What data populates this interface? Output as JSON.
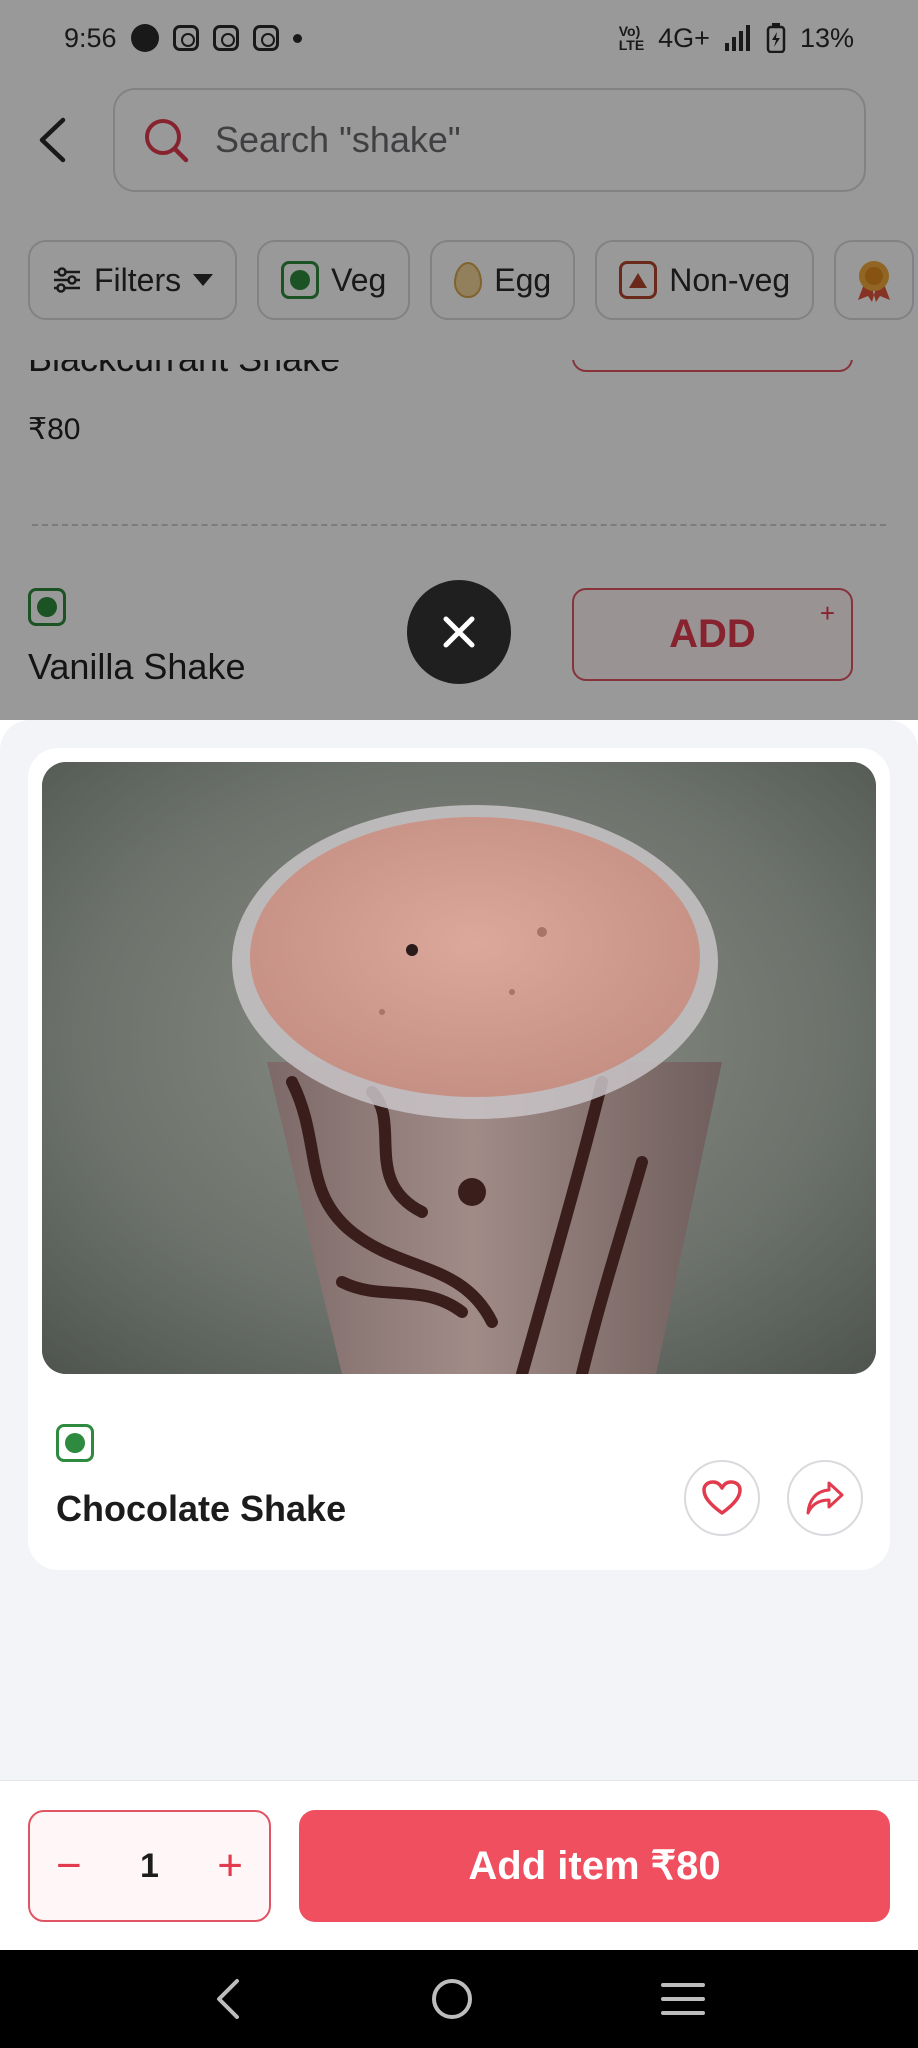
{
  "status_bar": {
    "time": "9:56",
    "network": "4G+",
    "battery": "13%"
  },
  "search": {
    "placeholder": "Search \"shake\""
  },
  "filters": [
    {
      "label": "Filters"
    },
    {
      "label": "Veg"
    },
    {
      "label": "Egg"
    },
    {
      "label": "Non-veg"
    }
  ],
  "list": {
    "item_partial_name": "Blackcurrant Shake",
    "item_partial_price": "₹80",
    "item_name": "Vanilla Shake",
    "add_label": "ADD",
    "add_plus": "+"
  },
  "product": {
    "name": "Chocolate Shake",
    "diet": "veg"
  },
  "cart": {
    "quantity": "1",
    "minus": "−",
    "plus": "+",
    "add_label": "Add item ₹80"
  },
  "colors": {
    "brand": "#ef4f5f",
    "veg": "#2d8a3e",
    "nonveg": "#b1452c"
  },
  "icons": [
    "back-arrow-icon",
    "search-icon",
    "filter-sliders-icon",
    "caret-down-icon",
    "close-icon",
    "heart-icon",
    "share-icon",
    "nav-back-icon",
    "nav-home-icon",
    "nav-recents-icon"
  ]
}
